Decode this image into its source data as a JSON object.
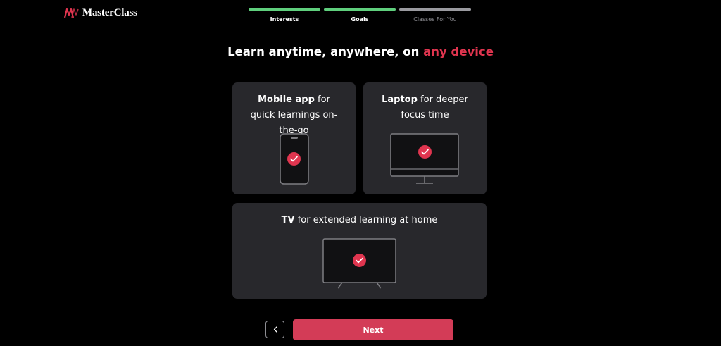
{
  "brand": {
    "name": "MasterClass",
    "accent_color": "#e0354f"
  },
  "steps": [
    {
      "label": "Interests",
      "status": "done"
    },
    {
      "label": "Goals",
      "status": "done"
    },
    {
      "label": "Classes For You",
      "status": "pending"
    }
  ],
  "headline": {
    "prefix": "Learn anytime, anywhere, on ",
    "highlight": "any device"
  },
  "cards": {
    "mobile": {
      "bold": "Mobile app",
      "rest": " for quick learnings on-the-go",
      "selected": true,
      "icon": "phone-icon"
    },
    "laptop": {
      "bold": "Laptop",
      "rest": " for deeper focus time",
      "selected": true,
      "icon": "monitor-icon"
    },
    "tv": {
      "bold": "TV",
      "rest": " for extended learning at home",
      "selected": true,
      "icon": "tv-icon"
    }
  },
  "buttons": {
    "back_icon": "chevron-left-icon",
    "next_label": "Next"
  }
}
